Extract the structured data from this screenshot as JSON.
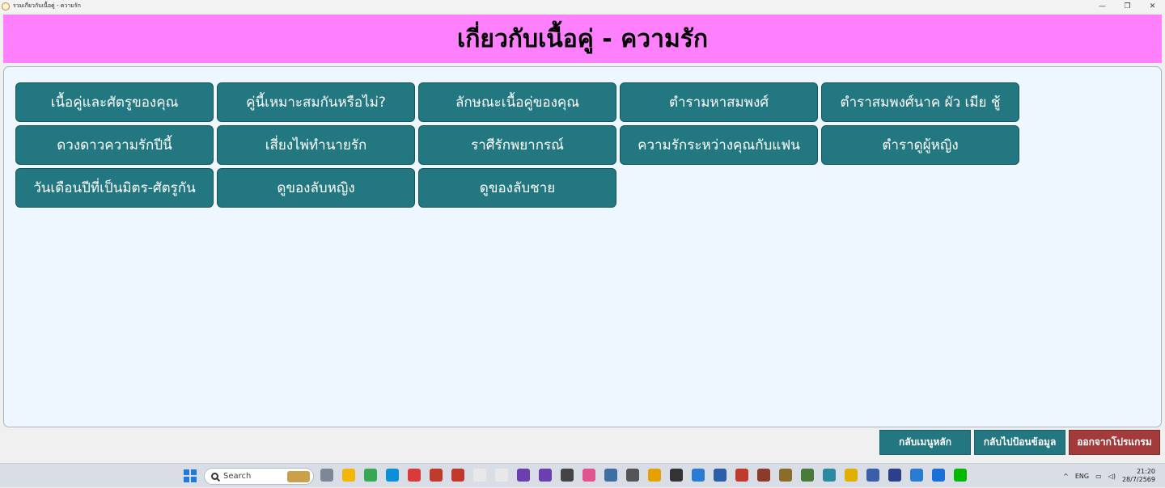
{
  "window": {
    "title": "รวมเกี่ยวกับเนื้อคู่ - ความรัก",
    "controls": [
      "—",
      "❐",
      "✕"
    ]
  },
  "header": {
    "title": "เกี่ยวกับเนื้อคู่ - ความรัก"
  },
  "menu": [
    "เนื้อคู่และศัตรูของคุณ",
    "คู่นี้เหมาะสมกันหรือไม่?",
    "ลักษณะเนื้อคู่ของคุณ",
    "ตำรามหาสมพงศ์",
    "ตำราสมพงศ์นาค ผัว เมีย ชู้",
    "ดวงดาวความรักปีนี้",
    "เสี่ยงไพ่ทำนายรัก",
    "ราศีรักพยากรณ์",
    "ความรักระหว่างคุณกับแฟน",
    "ตำราดูผู้หญิง",
    "วันเดือนปีที่เป็นมิตร-ศัตรูกัน",
    "ดูของลับหญิง",
    "ดูของลับชาย"
  ],
  "footer": {
    "main_menu": "กลับเมนูหลัก",
    "back_to_input": "กลับไปป้อนข้อมูล",
    "exit": "ออกจากโปรแกรม"
  },
  "taskbar": {
    "search_placeholder": "Search",
    "icons": [
      "#7d8796",
      "#f2b705",
      "#34a853",
      "#0a8fd8",
      "#d93a3a",
      "#c0392b",
      "#c0392b",
      "#e8e8e8",
      "#e8e8e8",
      "#6b3fb0",
      "#6b3fb0",
      "#444444",
      "#e0558f",
      "#3f6ea3",
      "#555555",
      "#e6a100",
      "#333333",
      "#2b7bd3",
      "#2b5fa8",
      "#c0392b",
      "#8a3b2a",
      "#8a6d2a",
      "#4a7a3a",
      "#2a8aa3",
      "#e0b000",
      "#3a5fa8",
      "#2b3f8a",
      "#2b7bd3",
      "#1a6fd8",
      "#00b900"
    ],
    "language": "ENG",
    "time": "21:20",
    "date": "28/7/2569"
  }
}
